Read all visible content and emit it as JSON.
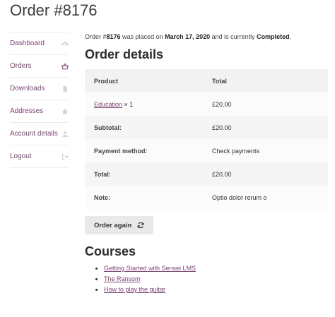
{
  "page": {
    "title": "Order #8176"
  },
  "nav": {
    "items": [
      {
        "label": "Dashboard",
        "icon": "dashboard-icon"
      },
      {
        "label": "Orders",
        "icon": "basket-icon"
      },
      {
        "label": "Downloads",
        "icon": "file-icon"
      },
      {
        "label": "Addresses",
        "icon": "home-icon"
      },
      {
        "label": "Account details",
        "icon": "user-icon"
      },
      {
        "label": "Logout",
        "icon": "logout-icon"
      }
    ]
  },
  "summary": {
    "prefix": "Order #",
    "order_number": "8176",
    "middle": " was placed on ",
    "date": "March 17, 2020",
    "middle2": " and is currently ",
    "status": "Completed",
    "suffix": "."
  },
  "order_details": {
    "heading": "Order details",
    "col_product": "Product",
    "col_total": "Total",
    "item": {
      "product": "Education",
      "qty": " × 1",
      "total": "£20.00"
    },
    "subtotal_label": "Subtotal:",
    "subtotal": "£20.00",
    "payment_label": "Payment method:",
    "payment": "Check payments",
    "total_label": "Total:",
    "total": "£20.00",
    "note_label": "Note:",
    "note": "Optio dolor rerum o"
  },
  "actions": {
    "order_again": "Order again"
  },
  "courses": {
    "heading": "Courses",
    "items": [
      "Getting Started with Sensei LMS",
      "The Ransom",
      "How to play the guitar"
    ]
  },
  "colors": {
    "accent": "#7b4371",
    "button_bg": "#e9e9ea",
    "table_bg": "#f5f5f5"
  }
}
